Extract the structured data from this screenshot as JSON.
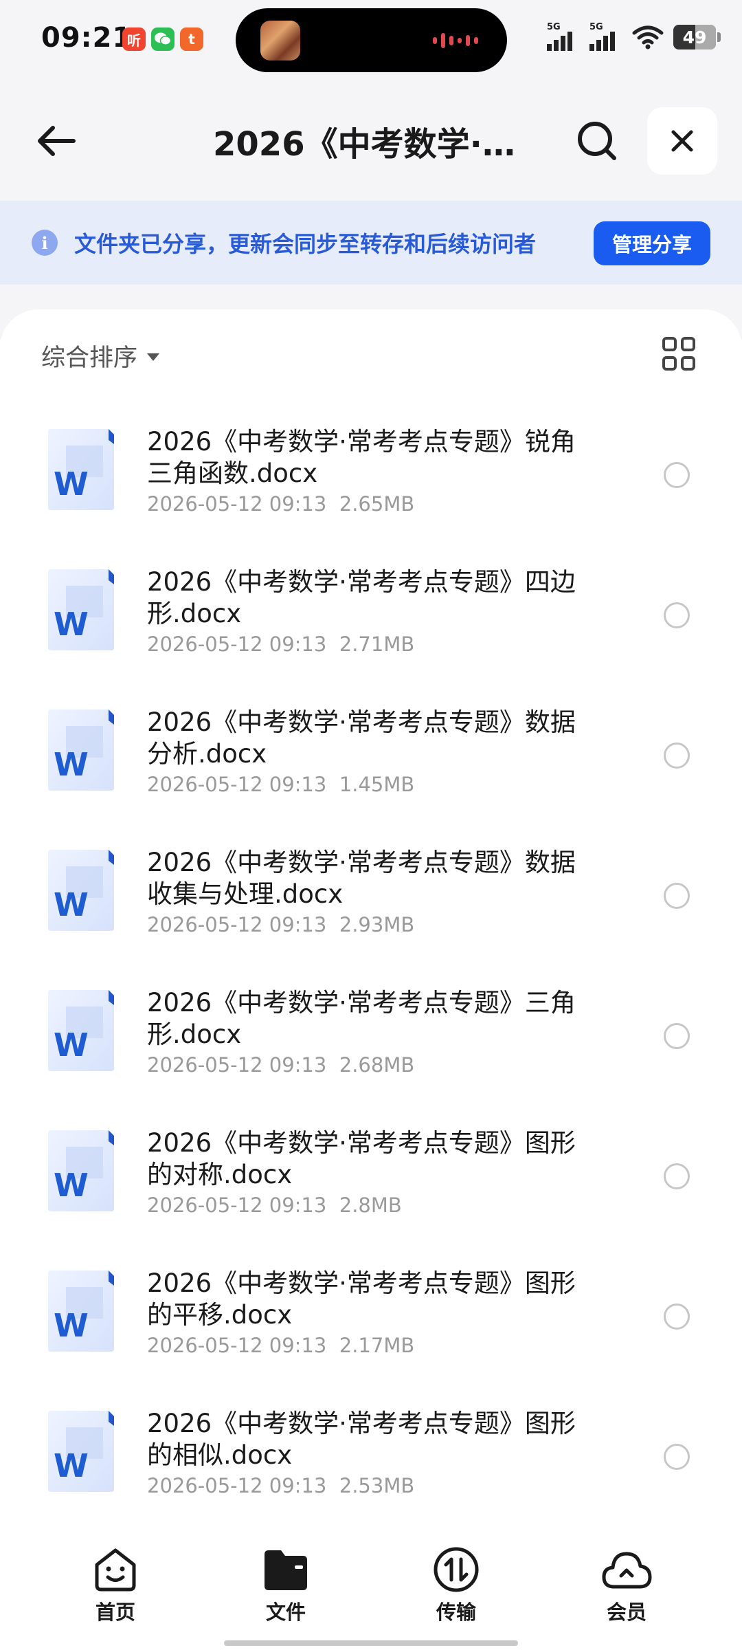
{
  "status_bar": {
    "time": "09:21",
    "app_badges": [
      {
        "icon": "ting-app-icon",
        "text": "听",
        "color": "#f0442e"
      },
      {
        "icon": "wechat-icon",
        "text": "",
        "color": "#2dbe55"
      },
      {
        "icon": "taobao-icon",
        "text": "t",
        "color": "#f2682a"
      }
    ],
    "signal_1_label": "5G",
    "signal_2_label": "5G",
    "battery_level": "49"
  },
  "header": {
    "title": "2026《中考数学·…"
  },
  "share_banner": {
    "message": "文件夹已分享，更新会同步至转存和后续访问者",
    "manage_button": "管理分享"
  },
  "toolbar": {
    "sort_label": "综合排序"
  },
  "files": [
    {
      "name": "2026《中考数学·常考考点专题》锐角三角函数.docx",
      "date": "2026-05-12 09:13",
      "size": "2.65MB",
      "type": "word-doc-icon"
    },
    {
      "name": "2026《中考数学·常考考点专题》四边形.docx",
      "date": "2026-05-12 09:13",
      "size": "2.71MB",
      "type": "word-doc-icon"
    },
    {
      "name": "2026《中考数学·常考考点专题》数据分析.docx",
      "date": "2026-05-12 09:13",
      "size": "1.45MB",
      "type": "word-doc-icon"
    },
    {
      "name": "2026《中考数学·常考考点专题》数据收集与处理.docx",
      "date": "2026-05-12 09:13",
      "size": "2.93MB",
      "type": "word-doc-icon"
    },
    {
      "name": "2026《中考数学·常考考点专题》三角形.docx",
      "date": "2026-05-12 09:13",
      "size": "2.68MB",
      "type": "word-doc-icon"
    },
    {
      "name": "2026《中考数学·常考考点专题》图形的对称.docx",
      "date": "2026-05-12 09:13",
      "size": "2.8MB",
      "type": "word-doc-icon"
    },
    {
      "name": "2026《中考数学·常考考点专题》图形的平移.docx",
      "date": "2026-05-12 09:13",
      "size": "2.17MB",
      "type": "word-doc-icon"
    },
    {
      "name": "2026《中考数学·常考考点专题》图形的相似.docx",
      "date": "2026-05-12 09:13",
      "size": "2.53MB",
      "type": "word-doc-icon"
    }
  ],
  "bottom_nav": [
    {
      "label": "首页",
      "icon": "home-face-icon"
    },
    {
      "label": "文件",
      "icon": "folder-icon",
      "active": true
    },
    {
      "label": "传输",
      "icon": "transfer-icon"
    },
    {
      "label": "会员",
      "icon": "cloud-member-icon"
    }
  ],
  "colors": {
    "accent": "#1a5cf0",
    "banner_bg": "#e7ecfb",
    "banner_text": "#2a5bd7",
    "page_bg": "#f5f5f7"
  }
}
